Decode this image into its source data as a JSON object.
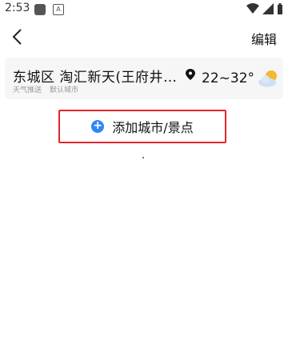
{
  "status_bar": {
    "time": "2:53",
    "notification_letter": "A"
  },
  "header": {
    "edit_label": "编辑"
  },
  "city": {
    "name": "东城区 淘汇新天(王府井…",
    "tags": [
      "天气推送",
      "默认城市"
    ],
    "temperature": "22~32°",
    "weather_icon": "partly-cloudy-icon"
  },
  "add_city": {
    "label": "添加城市/景点",
    "icon": "plus-circle-icon"
  },
  "colors": {
    "accent_blue": "#2f86f6",
    "highlight_red": "#e0262b"
  }
}
